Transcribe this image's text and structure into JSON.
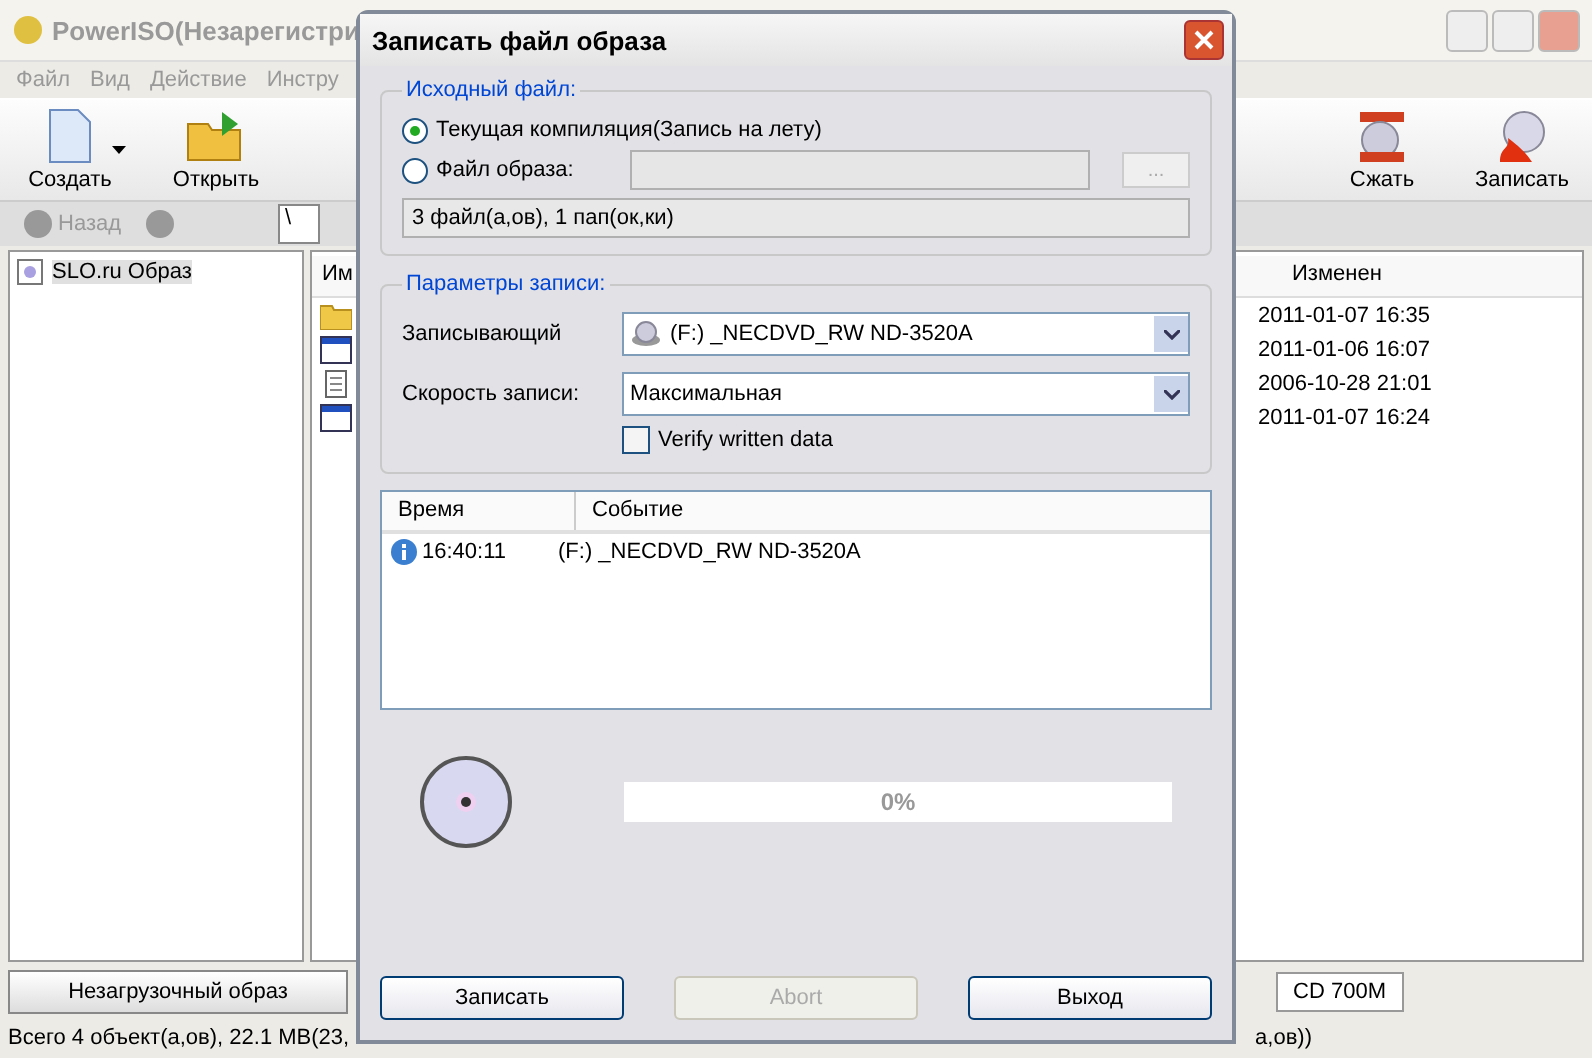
{
  "main_window": {
    "title": "PowerISO(Незарегистри",
    "menu": [
      "Файл",
      "Вид",
      "Действие",
      "Инстру"
    ],
    "toolbar": [
      {
        "label": "Создать",
        "kind": "new",
        "dropdown": true
      },
      {
        "label": "Открыть",
        "kind": "open",
        "dropdown": false
      },
      {
        "label": "Сжать",
        "kind": "compress",
        "dropdown": false
      },
      {
        "label": "Записать",
        "kind": "burn",
        "dropdown": false
      }
    ],
    "nav": {
      "back": "Назад",
      "path": "\\"
    },
    "tree": [
      {
        "label": "SLO.ru Образ",
        "selected": true
      }
    ],
    "list": {
      "columns": [
        "Им",
        "Изменен"
      ],
      "rows": [
        {
          "kind": "folder",
          "modified": "2011-01-07 16:35"
        },
        {
          "kind": "window",
          "modified": "2011-01-06 16:07"
        },
        {
          "kind": "note",
          "modified": "2006-10-28 21:01"
        },
        {
          "kind": "window",
          "modified": "2011-01-07 16:24"
        }
      ]
    },
    "boot_button": "Незагрузочный образ",
    "media": "CD 700M",
    "status_bar": [
      "Всего 4 объект(а,ов), 22.1 MB(23,",
      "а,ов))"
    ]
  },
  "dialog": {
    "title": "Записать файл образа",
    "source": {
      "legend": "Исходный файл:",
      "options": [
        {
          "label": "Текущая компиляция(Запись на лету)",
          "selected": true
        },
        {
          "label": "Файл образа:",
          "selected": false
        }
      ],
      "browse": "...",
      "info": "3 файл(а,ов), 1 пап(ок,ки)"
    },
    "params": {
      "legend": "Параметры записи:",
      "writer_label": "Записывающий",
      "writer": "(F:) _NECDVD_RW ND-3520A",
      "speed_label": "Скорость записи:",
      "speed": "Максимальная",
      "verify": {
        "label": "Verify written data",
        "checked": false
      }
    },
    "log": {
      "columns": [
        "Время",
        "Событие"
      ],
      "rows": [
        {
          "time": "16:40:11",
          "event": "(F:) _NECDVD_RW ND-3520A"
        }
      ]
    },
    "progress": {
      "level": 0,
      "reading": "0%"
    },
    "buttons": [
      {
        "label": "Записать",
        "disabled": false
      },
      {
        "label": "Abort",
        "disabled": true
      },
      {
        "label": "Выход",
        "disabled": false
      }
    ]
  }
}
